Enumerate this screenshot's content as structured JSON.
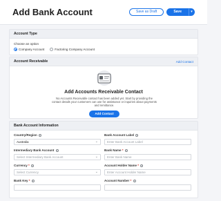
{
  "header": {
    "title": "Add Bank Account",
    "save_draft_label": "Save as Draft",
    "save_label": "Save",
    "save_more_glyph": "▾"
  },
  "account_type": {
    "section_title": "Account Type",
    "choose_label": "Choose an option",
    "options": [
      {
        "label": "Company Account",
        "selected": true
      },
      {
        "label": "Factoring Company Account",
        "selected": false
      }
    ]
  },
  "account_receivable": {
    "section_title": "Account Receivable",
    "add_link": "Add Contact",
    "empty_heading": "Add Accounts Receivable Contact",
    "empty_description": "No Accounts Receivable contact has been added yet. Start by providing the contact details your customers can use for assistance or inquiries about payments and remittance.",
    "add_button": "Add Contact",
    "illustration": "contact-card-icon"
  },
  "bank_info": {
    "section_title": "Bank Account Information",
    "fields": {
      "country_label": "Country/Region",
      "country_value": "Australia",
      "label_label": "Bank Account Label",
      "label_placeholder": "Enter Bank Account Label",
      "intermediary_label": "Intermediary Bank Account",
      "intermediary_placeholder": "Select Intermediary Bank Account",
      "bank_name_label": "Bank Name",
      "bank_name_placeholder": "Enter Bank Name",
      "currency_label": "Currency",
      "currency_placeholder": "Select Currency",
      "holder_label": "Account Holder Name",
      "holder_placeholder": "Enter Account Holder Name",
      "bank_key_label": "Bank Key",
      "account_number_label": "Account Number"
    },
    "required_marker": "*",
    "info_glyph": "i",
    "chevron_glyph": "⌄"
  },
  "colors": {
    "accent": "#1a73e8",
    "required": "#d93025",
    "section_header_bg": "#eef0f4",
    "page_bg": "#f4f5f8"
  }
}
